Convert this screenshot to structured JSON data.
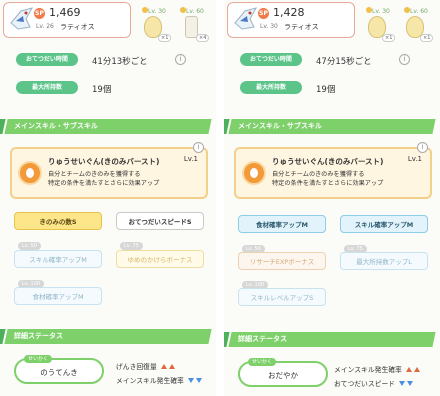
{
  "left": {
    "header": {
      "sp": "1,469",
      "sp_label": "SP",
      "level": "Lv. 26",
      "name": "ラティオス",
      "items": [
        {
          "lv": "Lv. 30",
          "badge": "×1",
          "icon": "egg-icon"
        },
        {
          "lv": "Lv. 60",
          "badge": "×4",
          "icon": "bottle-icon"
        }
      ]
    },
    "help_label": "おてつだい時間",
    "help_value": "41分13秒ごと",
    "max_label": "最大所持数",
    "max_value": "19個",
    "skills_header": "メインスキル・サブスキル",
    "main_skill": {
      "name": "りゅうせいぐん(きのみバースト)",
      "lv": "Lv.1",
      "desc": "自分とチームのきのみを獲得する\n特定の条件を満たすとさらに効果アップ"
    },
    "sub_skills": [
      {
        "tag": "",
        "label": "きのみの数S"
      },
      {
        "tag": "",
        "label": "おてつだいスピードS"
      },
      {
        "tag": "Lv. 50",
        "label": "スキル確率アップM"
      },
      {
        "tag": "Lv. 75",
        "label": "ゆめのかけらボーナス"
      },
      {
        "tag": "Lv. 100",
        "label": "食材確率アップM"
      }
    ],
    "detail_header": "詳細ステータス",
    "nature": {
      "tag": "せいかく",
      "value": "のうてんき"
    },
    "effects": [
      {
        "label": "げんき回復量",
        "dir": "up"
      },
      {
        "label": "メインスキル発生確率",
        "dir": "down"
      }
    ]
  },
  "right": {
    "header": {
      "sp": "1,428",
      "sp_label": "SP",
      "level": "Lv. 30",
      "name": "ラティオス",
      "items": [
        {
          "lv": "Lv. 30",
          "badge": "×1",
          "icon": "egg-icon"
        },
        {
          "lv": "Lv. 60",
          "badge": "×1",
          "icon": "egg-icon"
        }
      ]
    },
    "help_label": "おてつだい時間",
    "help_value": "47分15秒ごと",
    "max_label": "最大所持数",
    "max_value": "19個",
    "skills_header": "メインスキル・サブスキル",
    "main_skill": {
      "name": "りゅうせいぐん(きのみバースト)",
      "lv": "Lv.1",
      "desc": "自分とチームのきのみを獲得する\n特定の条件を満たすとさらに効果アップ"
    },
    "sub_skills": [
      {
        "tag": "",
        "label": "食材確率アップM"
      },
      {
        "tag": "",
        "label": "スキル確率アップM"
      },
      {
        "tag": "Lv. 50",
        "label": "リサーチEXPボーナス"
      },
      {
        "tag": "Lv. 75",
        "label": "最大所持数アップL"
      },
      {
        "tag": "Lv. 100",
        "label": "スキルレベルアップS"
      }
    ],
    "detail_header": "詳細ステータス",
    "nature": {
      "tag": "せいかく",
      "value": "おだやか"
    },
    "effects": [
      {
        "label": "メインスキル発生確率",
        "dir": "up"
      },
      {
        "label": "おてつだいスピード",
        "dir": "down"
      }
    ]
  }
}
